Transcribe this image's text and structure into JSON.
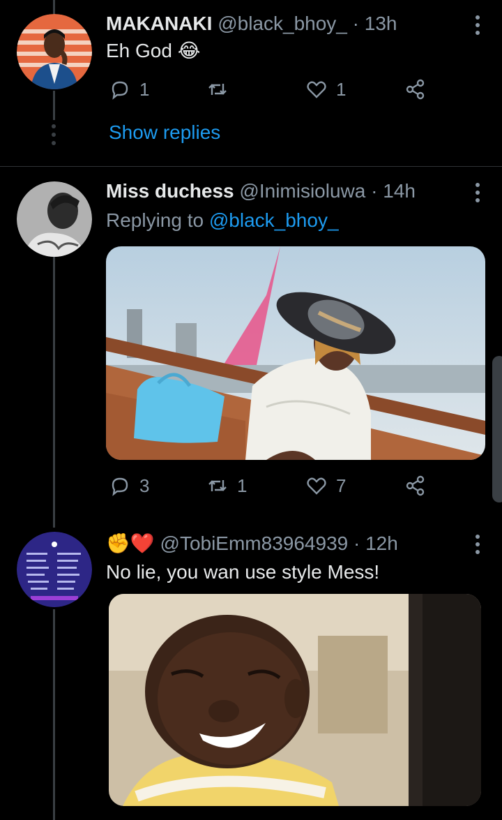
{
  "tweets": [
    {
      "name": "MAKANAKI",
      "handle": "@black_bhoy_",
      "time": "· 13h",
      "text": "Eh God",
      "emoji": "😂",
      "replies": "1",
      "retweets": "",
      "likes": "1",
      "show_replies": "Show replies"
    },
    {
      "name": "Miss duchess",
      "handle": "@Inimisioluwa",
      "time": "· 14h",
      "replying_prefix": "Replying to",
      "replying_handle": "@black_bhoy_",
      "replies": "3",
      "retweets": "1",
      "likes": "7"
    },
    {
      "name_emoji": "✊❤️",
      "handle": "@TobiEmm83964939",
      "time": "· 12h",
      "text": "No lie, you wan use style Mess!"
    }
  ],
  "colors": {
    "background": "#000000",
    "link": "#1d9bf0",
    "muted": "#8b98a5",
    "text": "#e7e9ea"
  }
}
